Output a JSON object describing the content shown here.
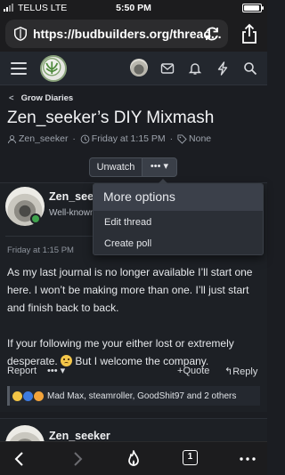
{
  "status_bar": {
    "carrier": "TELUS  LTE",
    "time": "5:50 PM"
  },
  "browser": {
    "url": "https://budbuilders.org/thread..."
  },
  "forum_header": {
    "icons": [
      "menu-icon",
      "site-logo",
      "user-avatar",
      "inbox-icon",
      "bell-icon",
      "bolt-icon",
      "search-icon"
    ]
  },
  "page": {
    "breadcrumb": "Grow Diaries",
    "title": "Zen_seeker’s DIY Mixmash",
    "meta": {
      "author": "Zen_seeker",
      "date": "Friday at 1:15 PM",
      "tags": "None"
    },
    "buttons": {
      "unwatch": "Unwatch",
      "more": "••• ▾"
    }
  },
  "dropdown": {
    "header": "More options",
    "items": [
      "Edit thread",
      "Create poll"
    ]
  },
  "post": {
    "username": "Zen_seeker",
    "role": "Well-known",
    "date": "Friday at 1:15 PM",
    "paragraph_1": "As my last journal is no longer available I’ll start one here. I won’t be making more than one. I’ll just start and finish back to back.",
    "paragraph_2a": "If your following me your either lost or extremely desperate. ",
    "paragraph_2b": " But I welcome the company.",
    "actions": {
      "report": "Report",
      "more": "••• ▾",
      "quote": "Quote",
      "reply": "Reply"
    },
    "reactions_text": "Mad Max, steamroller, GoodShit97 and 2 others"
  },
  "next_post": {
    "username": "Zen_seeker"
  },
  "toolbar": {
    "tab_count": "1"
  },
  "colors": {
    "page_bg": "#1b1d22",
    "header_bg": "#23272e",
    "accent_green": "#3fa34d",
    "menu_bg": "#2b2f36"
  }
}
